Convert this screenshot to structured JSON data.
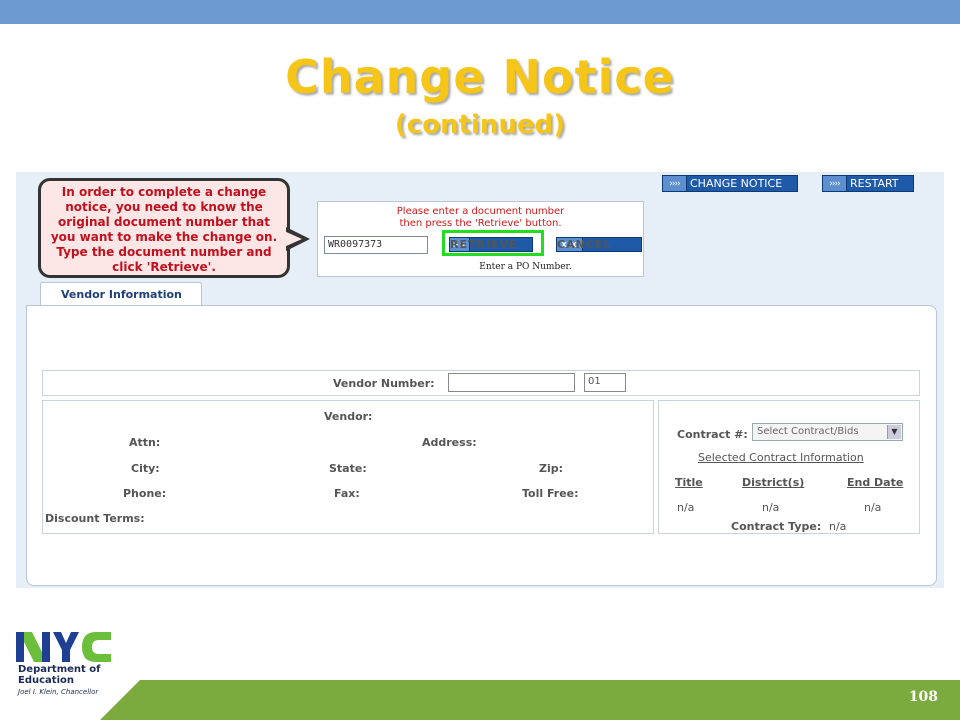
{
  "slide": {
    "title": "Change Notice",
    "subtitle": "(continued)",
    "page_number": "108"
  },
  "colors": {
    "top_bar": "#6b9bd1",
    "title": "#f5c518",
    "footer_green": "#7bab3e",
    "button_blue": "#1e5aa8",
    "highlight_green": "#22dd22",
    "callout_text": "#c0111f"
  },
  "callout": {
    "lines": [
      "In order to complete a change",
      "notice, you need to know the",
      "original document number that",
      "you want to make the change on.",
      "Type the document number and",
      "click 'Retrieve'."
    ]
  },
  "header_buttons": {
    "change_notice": "CHANGE NOTICE",
    "restart": "RESTART",
    "chevron_glyph": "››››"
  },
  "retrieve_form": {
    "message_line1": "Please enter a document number",
    "message_line2": "then press the 'Retrieve' button.",
    "document_number": "WR0097373",
    "retrieve_label": "RETRIEVE",
    "retrieve_icon": ">>",
    "cancel_label": "CANCEL",
    "cancel_icon": "X X",
    "hint": "Enter a PO Number."
  },
  "tab": {
    "label": "Vendor Information"
  },
  "vendor_number": {
    "label": "Vendor Number:",
    "value": "",
    "suffix": "01"
  },
  "vendor_details": {
    "vendor_label": "Vendor:",
    "attn_label": "Attn:",
    "address_label": "Address:",
    "city_label": "City:",
    "state_label": "State:",
    "zip_label": "Zip:",
    "phone_label": "Phone:",
    "fax_label": "Fax:",
    "toll_free_label": "Toll Free:",
    "discount_terms_label": "Discount Terms:"
  },
  "contract": {
    "label": "Contract #:",
    "select_value": "Select Contract/Bids",
    "selected_info_link": "Selected Contract Information",
    "columns": [
      "Title",
      "District(s)",
      "End Date"
    ],
    "values": [
      "n/a",
      "n/a",
      "n/a"
    ],
    "type_label": "Contract Type:",
    "type_value": "n/a"
  },
  "logo": {
    "nyc": "NYC",
    "dept_line1": "Department of",
    "dept_line2": "Education",
    "chancellor": "Joel I. Klein, Chancellor"
  }
}
